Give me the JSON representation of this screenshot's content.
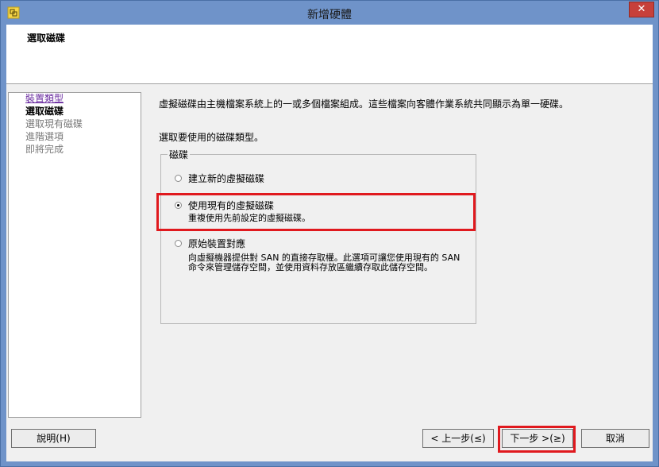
{
  "window": {
    "title": "新增硬體",
    "close_glyph": "✕"
  },
  "header": {
    "title": "選取磁碟"
  },
  "steps": [
    {
      "label": "裝置類型",
      "state": "link"
    },
    {
      "label": "選取磁碟",
      "state": "current"
    },
    {
      "label": "選取現有磁碟",
      "state": "future"
    },
    {
      "label": "進階選項",
      "state": "future"
    },
    {
      "label": "即將完成",
      "state": "future"
    }
  ],
  "main": {
    "description": "虛擬磁碟由主機檔案系統上的一或多個檔案組成。這些檔案向客體作業系統共同顯示為單一硬碟。",
    "prompt": "選取要使用的磁碟類型。",
    "group_label": "磁碟",
    "options": [
      {
        "label": "建立新的虛擬磁碟",
        "desc": "",
        "checked": false
      },
      {
        "label": "使用現有的虛擬磁碟",
        "desc": "重複使用先前設定的虛擬磁碟。",
        "checked": true
      },
      {
        "label": "原始裝置對應",
        "desc": "向虛擬機器提供對 SAN 的直接存取權。此選項可讓您使用現有的 SAN 命令來管理儲存空間，並使用資料存放區繼續存取此儲存空間。",
        "checked": false
      }
    ]
  },
  "buttons": {
    "help": "說明(H)",
    "back": "< 上一步(≤)",
    "next": "下一步 >(≥)",
    "cancel": "取消"
  },
  "colors": {
    "highlight": "#e0191e",
    "titlebar": "#6f93c9",
    "link": "#6a2ca0"
  }
}
